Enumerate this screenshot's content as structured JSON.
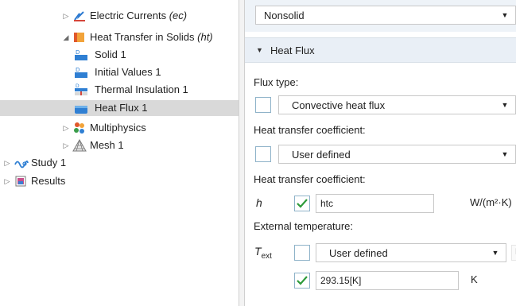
{
  "tree": {
    "items": [
      {
        "label": "Electric Currents",
        "tag": "(ec)",
        "icon": "electric-currents-icon"
      },
      {
        "label": "Heat Transfer in Solids",
        "tag": "(ht)",
        "icon": "heat-transfer-icon"
      },
      {
        "label": "Solid 1",
        "tag": "",
        "icon": "solid-icon"
      },
      {
        "label": "Initial Values 1",
        "tag": "",
        "icon": "initial-values-icon"
      },
      {
        "label": "Thermal Insulation 1",
        "tag": "",
        "icon": "thermal-insulation-icon"
      },
      {
        "label": "Heat Flux 1",
        "tag": "",
        "icon": "heat-flux-icon"
      },
      {
        "label": "Multiphysics",
        "tag": "",
        "icon": "multiphysics-icon"
      },
      {
        "label": "Mesh 1",
        "tag": "",
        "icon": "mesh-icon"
      },
      {
        "label": "Study 1",
        "tag": "",
        "icon": "study-icon"
      },
      {
        "label": "Results",
        "tag": "",
        "icon": "results-icon"
      }
    ],
    "selected": "Heat Flux 1"
  },
  "settings": {
    "material_type_value": "Nonsolid",
    "section_title": "Heat Flux",
    "flux_type_label": "Flux type:",
    "flux_type_value": "Convective heat flux",
    "htc_type_label": "Heat transfer coefficient:",
    "htc_type_value": "User defined",
    "htc_value_label": "Heat transfer coefficient:",
    "htc_symbol": "h",
    "htc_value": "htc",
    "htc_unit": "W/(m²·K)",
    "ext_temp_label": "External temperature:",
    "ext_temp_symbol": "T",
    "ext_temp_subscript": "ext",
    "ext_temp_type_value": "User defined",
    "ext_temp_value": "293.15[K]",
    "ext_temp_unit": "K"
  },
  "colors": {
    "selection": "#d9d9d9",
    "section_header": "#e9eff6",
    "check_green": "#2e9b3a",
    "checkbox_border": "#8fb3c9"
  }
}
